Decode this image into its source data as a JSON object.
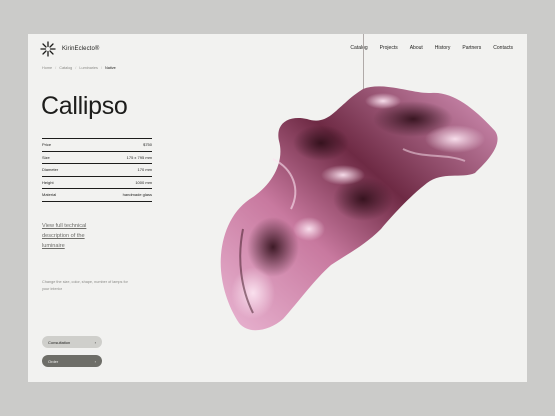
{
  "header": {
    "logo_text": "KirinEclecto®",
    "nav": [
      "Catalog",
      "Projects",
      "About",
      "History",
      "Partners",
      "Contacts"
    ]
  },
  "breadcrumb": [
    "Home",
    "Catalog",
    "Luminaries",
    "Native"
  ],
  "product": {
    "title": "Callipso",
    "specs": [
      {
        "label": "Price",
        "value": "$750"
      },
      {
        "label": "Size",
        "value": "175 x 795 mm"
      },
      {
        "label": "Diameter",
        "value": "170 mm"
      },
      {
        "label": "Height",
        "value": "1000 mm"
      },
      {
        "label": "Material",
        "value": "handmade glass"
      }
    ],
    "tech_link": "View full technical description of the luminaire",
    "note": "Change the size, color, shape, number of lamps for your interior",
    "buttons": {
      "consultation": "Consultation",
      "order": "Order",
      "arrow": "›"
    }
  },
  "colors": {
    "background": "#cbcbc9",
    "page": "#f2f2f0",
    "text": "#1d1d1b",
    "sculpture_light": "#e7b7d3",
    "sculpture_dark": "#3a1420"
  }
}
